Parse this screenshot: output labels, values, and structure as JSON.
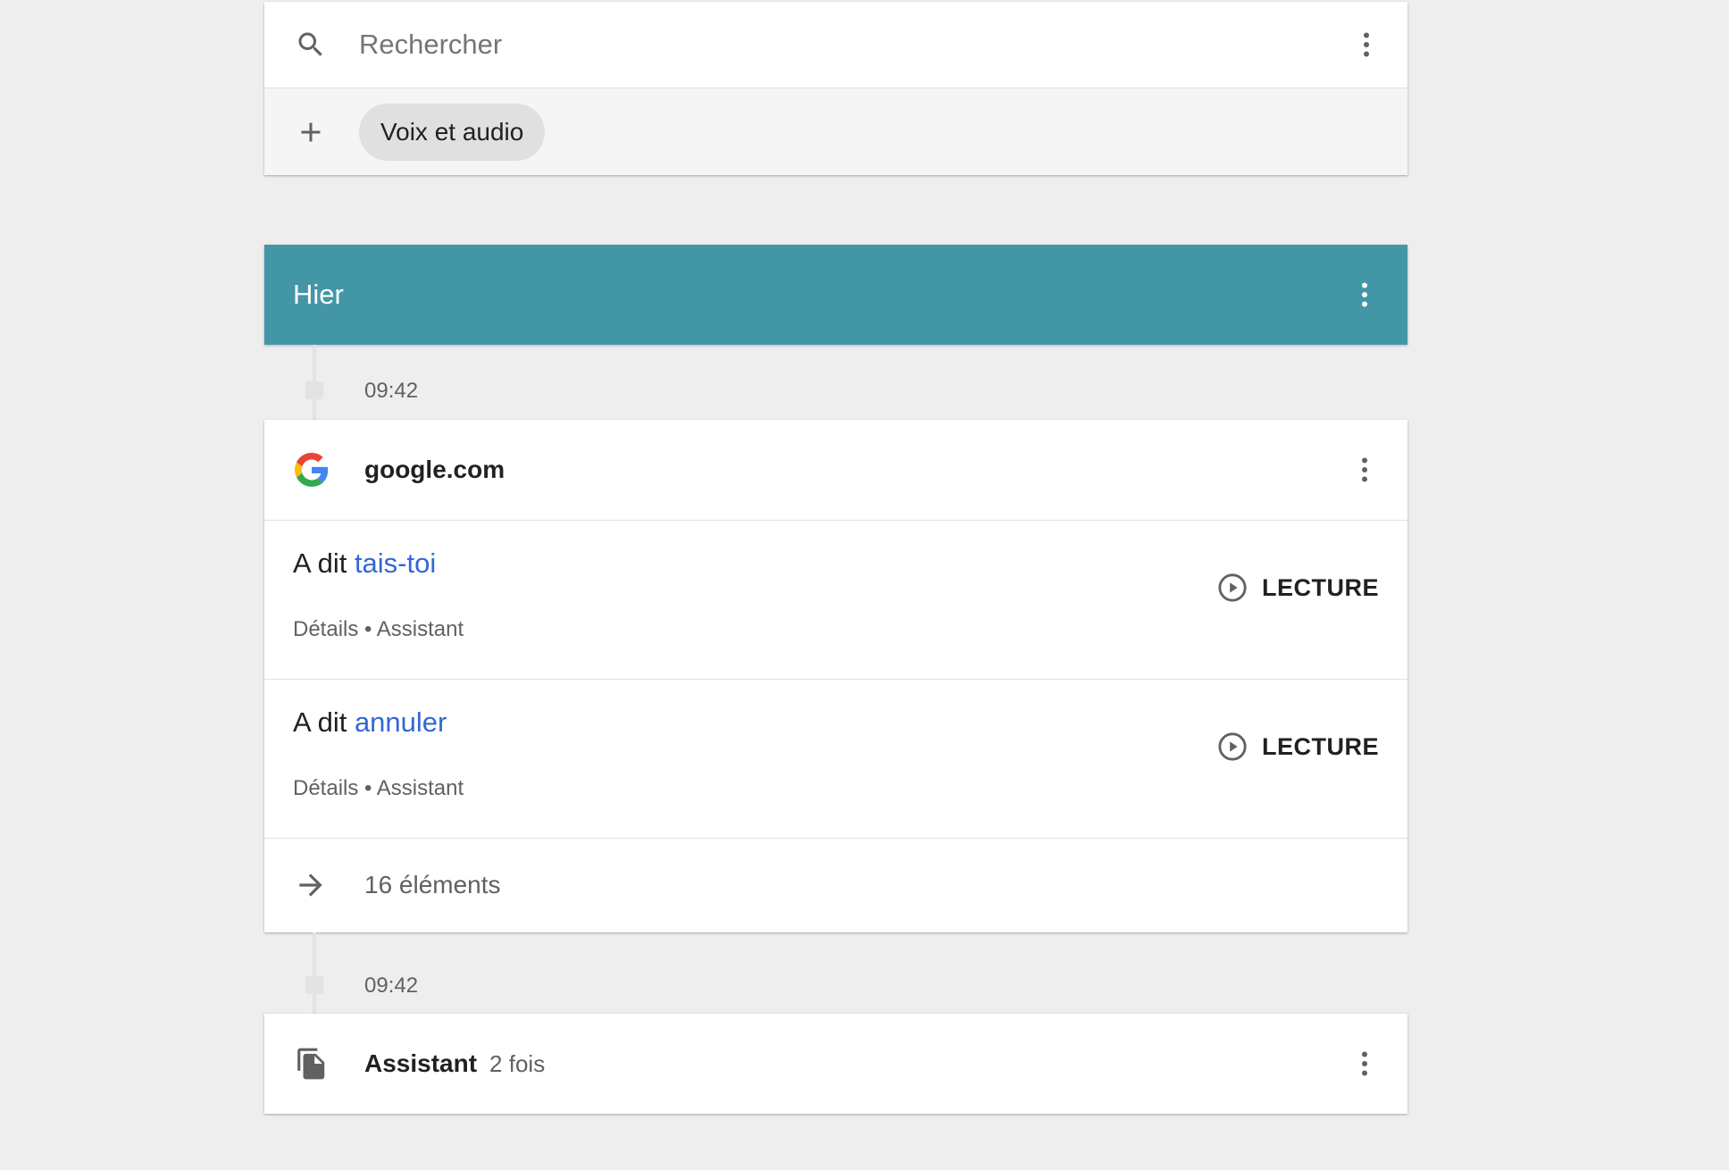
{
  "search": {
    "placeholder": "Rechercher",
    "icon": "search-icon",
    "menu_icon": "more-vert-icon"
  },
  "filter": {
    "add_icon": "add-icon",
    "chip_label": "Voix et audio"
  },
  "day": {
    "title": "Hier",
    "color": "#4396a6",
    "menu_icon": "more-vert-icon"
  },
  "groups": [
    {
      "time": "09:42",
      "site": "google.com",
      "site_icon": "google-g-icon",
      "entries": [
        {
          "prefix": "A dit ",
          "query": "tais-toi",
          "details": "Détails",
          "separator": "•",
          "product": "Assistant",
          "play_label": "LECTURE"
        },
        {
          "prefix": "A dit ",
          "query": "annuler",
          "details": "Détails",
          "separator": "•",
          "product": "Assistant",
          "play_label": "LECTURE"
        }
      ],
      "more_label": "16 éléments"
    },
    {
      "time": "09:42",
      "bundle_name": "Assistant",
      "bundle_count": "2 fois",
      "bundle_icon": "documents-icon"
    }
  ],
  "colors": {
    "link": "#3367d6",
    "header": "#4396a6",
    "background": "#eeeeee"
  }
}
